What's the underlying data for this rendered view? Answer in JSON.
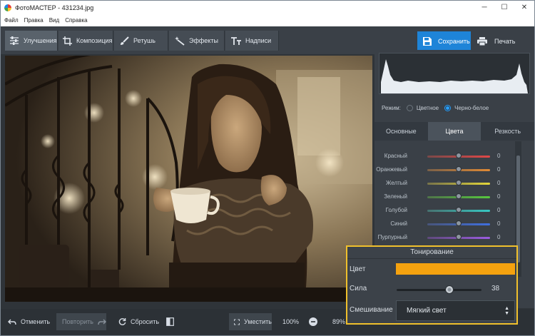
{
  "window": {
    "title": "ФотоМАСТЕР - 431234.jpg",
    "minimize": "─",
    "maximize": "☐",
    "close": "✕"
  },
  "menu": [
    "Файл",
    "Правка",
    "Вид",
    "Справка"
  ],
  "toolbar": {
    "tabs": [
      {
        "label": "Улучшения",
        "icon": "sliders-icon"
      },
      {
        "label": "Композиция",
        "icon": "crop-icon"
      },
      {
        "label": "Ретушь",
        "icon": "brush-icon"
      },
      {
        "label": "Эффекты",
        "icon": "wand-icon"
      },
      {
        "label": "Надписи",
        "icon": "text-icon"
      }
    ],
    "save_label": "Сохранить",
    "print_label": "Печать"
  },
  "side_panel": {
    "mode_label": "Режим:",
    "mode_options": [
      "Цветное",
      "Черно-белое"
    ],
    "mode_selected": "Черно-белое",
    "tabs": [
      "Основные",
      "Цвета",
      "Резкость"
    ],
    "active_tab": "Цвета",
    "color_rows": [
      {
        "label": "Красный",
        "value": "0",
        "gradient": "linear-gradient(90deg,#7a4848,#e04747)"
      },
      {
        "label": "Оранжевый",
        "value": "0",
        "gradient": "linear-gradient(90deg,#7a6048,#e08a35)"
      },
      {
        "label": "Желтый",
        "value": "0",
        "gradient": "linear-gradient(90deg,#77734a,#e3d63a)"
      },
      {
        "label": "Зеленый",
        "value": "0",
        "gradient": "linear-gradient(90deg,#4f7449,#57c73e)"
      },
      {
        "label": "Голубой",
        "value": "0",
        "gradient": "linear-gradient(90deg,#477270,#37c8c3)"
      },
      {
        "label": "Синий",
        "value": "0",
        "gradient": "linear-gradient(90deg,#48557a,#3f6fe0)"
      },
      {
        "label": "Пурпурный",
        "value": "0",
        "gradient": "linear-gradient(90deg,#5e4a7a,#9a5be0)"
      }
    ]
  },
  "toning": {
    "title": "Тонирование",
    "color_label": "Цвет",
    "color_value": "#f5a20f",
    "strength_label": "Сила",
    "strength_value": "38",
    "blend_label": "Смешивание",
    "blend_value": "Мягкий свет"
  },
  "bottom_bar": {
    "undo": "Отменить",
    "redo": "Повторить",
    "reset": "Сбросить",
    "fit": "Уместить",
    "zoom_100": "100%",
    "zoom_value": "89%"
  }
}
